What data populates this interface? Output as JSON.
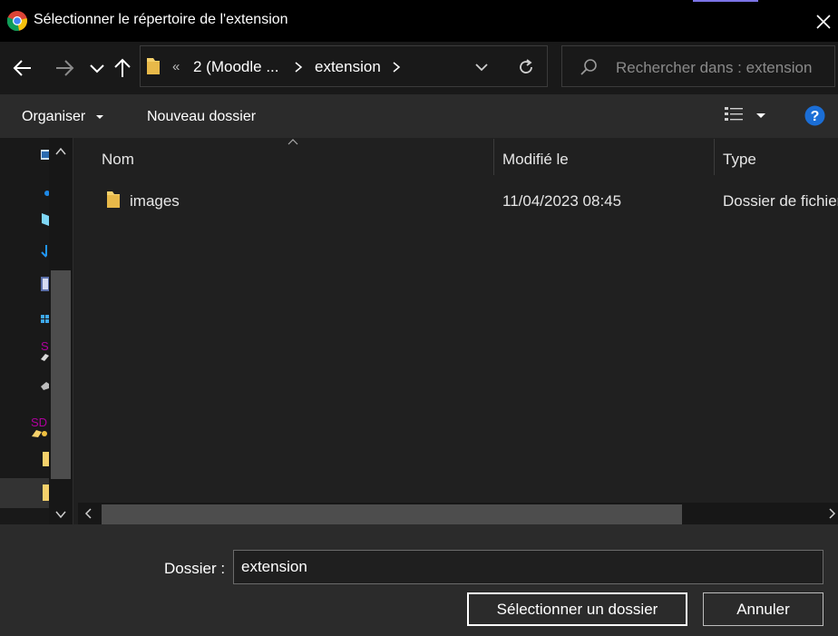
{
  "window": {
    "title": "Sélectionner le répertoire de l'extension"
  },
  "address": {
    "overflow": "«",
    "crumbs": [
      "2 (Moodle ...",
      "extension"
    ]
  },
  "search": {
    "placeholder": "Rechercher dans : extension"
  },
  "toolbar": {
    "organise": "Organiser",
    "new_folder": "Nouveau dossier"
  },
  "columns": {
    "name": "Nom",
    "modified": "Modifié le",
    "type": "Type"
  },
  "rows": [
    {
      "name": "images",
      "modified": "11/04/2023 08:45",
      "type": "Dossier de fichiers"
    }
  ],
  "sidebar": {
    "items": [
      {
        "icon": "computer-icon"
      },
      {
        "icon": "cloud-icon"
      },
      {
        "icon": "cube-icon"
      },
      {
        "icon": "download-icon"
      },
      {
        "icon": "film-icon"
      },
      {
        "icon": "windows-icon"
      },
      {
        "icon": "drive-s-icon",
        "label": "S"
      },
      {
        "icon": "drive-icon"
      },
      {
        "icon": "drive-sd-icon",
        "label": "SD"
      },
      {
        "icon": "folder-icon"
      },
      {
        "icon": "folder-icon"
      }
    ]
  },
  "footer": {
    "folder_label": "Dossier :",
    "folder_value": "extension",
    "select_button": "Sélectionner un dossier",
    "cancel_button": "Annuler"
  },
  "colors": {
    "accent": "#7b74e6",
    "help": "#1b6ed6",
    "folder": "#f5d16b"
  }
}
